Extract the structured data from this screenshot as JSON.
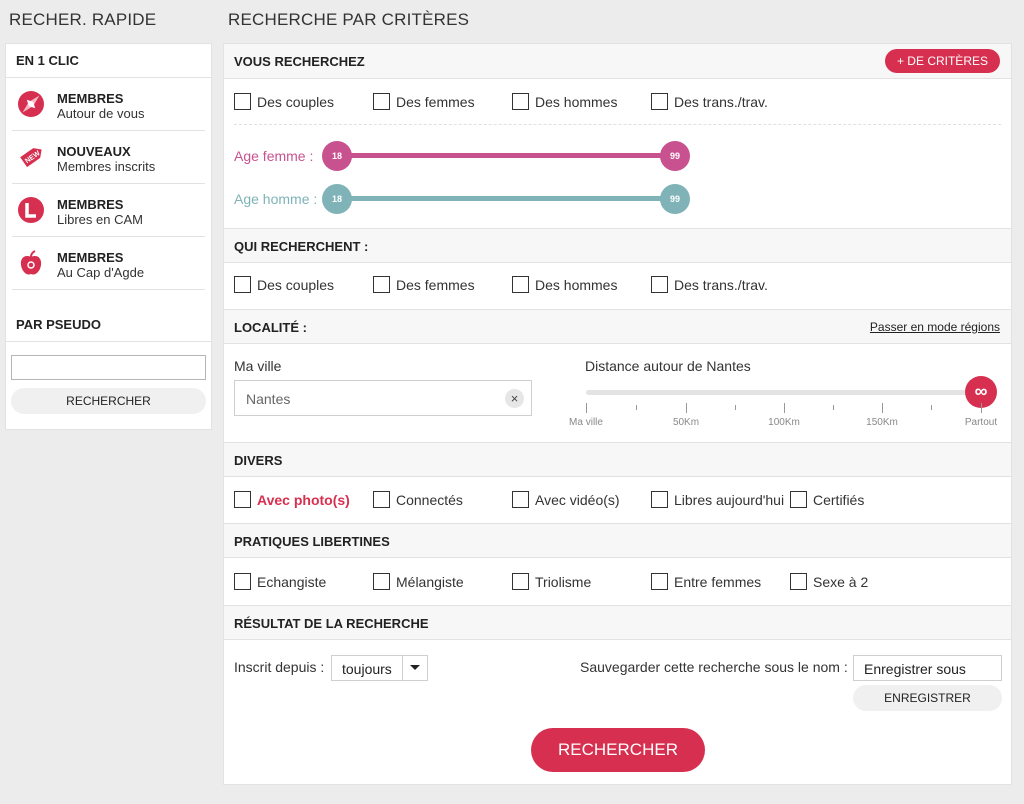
{
  "headings": {
    "quick_search": "RECHER. RAPIDE",
    "criteria_search": "RECHERCHE PAR CRITÈRES"
  },
  "left": {
    "one_click_title": "EN 1 CLIC",
    "quick_links": [
      {
        "icon": "compass-icon",
        "title": "MEMBRES",
        "subtitle": "Autour de vous"
      },
      {
        "icon": "new-tag-icon",
        "title": "NOUVEAUX",
        "subtitle": "Membres inscrits"
      },
      {
        "icon": "cam-icon",
        "title": "MEMBRES",
        "subtitle": "Libres en CAM"
      },
      {
        "icon": "cap-agde-icon",
        "title": "MEMBRES",
        "subtitle": "Au Cap d'Agde"
      }
    ],
    "pseudo_title": "PAR PSEUDO",
    "pseudo_value": "",
    "pseudo_button": "RECHERCHER"
  },
  "criteria": {
    "more_criteria_button": "+ DE CRITÈRES",
    "you_search": {
      "title": "VOUS RECHERCHEZ",
      "options": [
        "Des couples",
        "Des femmes",
        "Des hommes",
        "Des trans./trav."
      ]
    },
    "age_female": {
      "label": "Age femme :",
      "min": "18",
      "max": "99"
    },
    "age_male": {
      "label": "Age homme :",
      "min": "18",
      "max": "99"
    },
    "seeking": {
      "title": "QUI RECHERCHENT :",
      "options": [
        "Des couples",
        "Des femmes",
        "Des hommes",
        "Des trans./trav."
      ]
    },
    "location": {
      "title": "LOCALITÉ :",
      "regions_link": "Passer en mode régions",
      "city_label": "Ma ville",
      "city_value": "Nantes",
      "distance_label": "Distance autour de Nantes",
      "distance_value": "∞",
      "distance_ticks": [
        "Ma ville",
        "50Km",
        "100Km",
        "150Km",
        "Partout"
      ]
    },
    "misc": {
      "title": "DIVERS",
      "options": [
        "Avec photo(s)",
        "Connectés",
        "Avec vidéo(s)",
        "Libres aujourd'hui",
        "Certifiés"
      ]
    },
    "practices": {
      "title": "PRATIQUES LIBERTINES",
      "options": [
        "Echangiste",
        "Mélangiste",
        "Triolisme",
        "Entre femmes",
        "Sexe à 2"
      ]
    },
    "result": {
      "title": "RÉSULTAT DE LA RECHERCHE",
      "registered_label": "Inscrit depuis :",
      "registered_value": "toujours",
      "save_label": "Sauvegarder cette recherche sous le nom :",
      "save_value": "Enregistrer sous",
      "save_button": "ENREGISTRER",
      "search_button": "RECHERCHER"
    }
  },
  "colors": {
    "accent": "#d72f4f",
    "female": "#c8518f",
    "male": "#7fb3b7"
  }
}
